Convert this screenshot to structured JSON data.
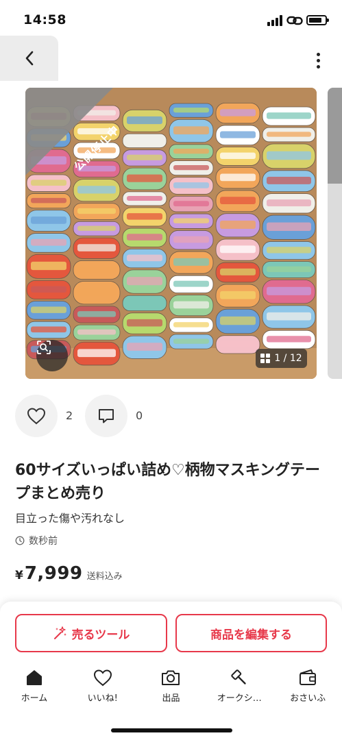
{
  "status_bar": {
    "time": "14:58"
  },
  "nav": {
    "back_icon": "chevron-left-icon",
    "more_icon": "more-vertical-icon"
  },
  "photo": {
    "status_banner": "公開停止中",
    "counter": "1 / 12",
    "zoom_icon": "scan-zoom-icon",
    "banner_color": "#888888"
  },
  "actions": {
    "like_count": "2",
    "comment_count": "0"
  },
  "item": {
    "title": "60サイズいっぱい詰め♡柄物マスキングテープまとめ売り",
    "condition": "目立った傷や汚れなし",
    "posted": "数秒前",
    "price_symbol": "¥",
    "price": "7,999",
    "shipping": "送料込み"
  },
  "buttons": {
    "sell_tool": "売るツール",
    "edit_item": "商品を編集する",
    "accent_color": "#e7384a"
  },
  "tabbar": {
    "items": [
      {
        "label": "ホーム",
        "icon": "home-icon"
      },
      {
        "label": "いいね!",
        "icon": "heart-icon"
      },
      {
        "label": "出品",
        "icon": "camera-icon"
      },
      {
        "label": "オークシ…",
        "icon": "gavel-icon"
      },
      {
        "label": "おさいふ",
        "icon": "wallet-icon"
      }
    ]
  }
}
